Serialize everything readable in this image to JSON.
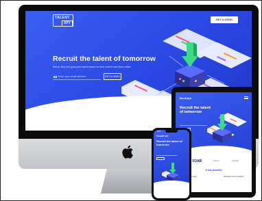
{
  "brand": {
    "logo_line1": "TALENT",
    "logo_line2": "API",
    "accent": "#2c49e6",
    "accent_light": "#3b5ef2"
  },
  "desktop": {
    "header_cta": "GET A DEMO",
    "hero_title": "Recruit the talent of tomorrow",
    "hero_subtitle": "Select, find and grow your talent based on their current and future skills",
    "email_placeholder": "Enter your email address",
    "hero_button": "GET A DEMO"
  },
  "tablet": {
    "logo": "TalentApi",
    "hero_title": "Recruit the talent of tomorrow",
    "partner_logos": [
      "VDAB",
      "Liantis",
      "partner"
    ],
    "section_title": "A few benefits",
    "feature_left": "Recruit the right people",
    "feature_right": "Redesign current workforce"
  },
  "phone": {
    "logo": "TALENT API",
    "hero_title": "Recruit the talent of tomorrow",
    "status_time": "9:41"
  },
  "icons": [
    "apple-logo-icon",
    "email-icon",
    "menu-icon",
    "isometric-dashboard-illustration"
  ]
}
